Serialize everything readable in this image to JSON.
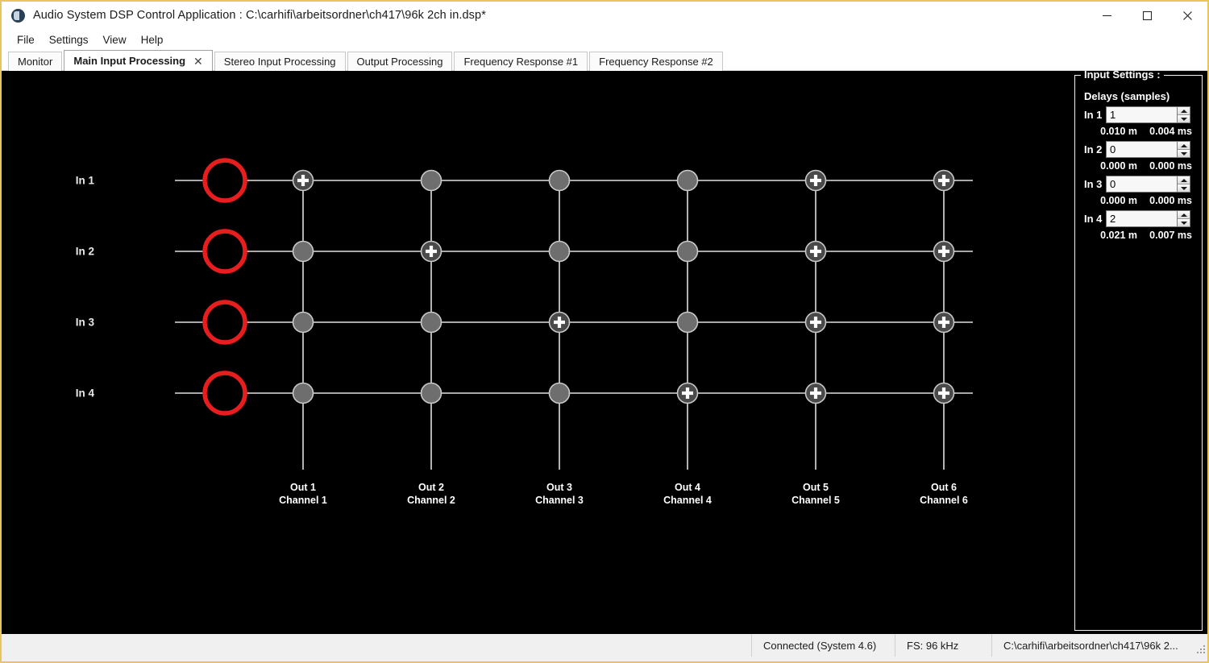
{
  "window": {
    "title": "Audio System DSP Control Application : C:\\carhifi\\arbeitsordner\\ch417\\96k 2ch in.dsp*",
    "icon": "app-speaker-icon",
    "minimize_label": "Minimize",
    "maximize_label": "Maximize",
    "close_label": "Close",
    "border_color": "#e8c65c"
  },
  "menubar": {
    "items": [
      {
        "label": "File"
      },
      {
        "label": "Settings"
      },
      {
        "label": "View"
      },
      {
        "label": "Help"
      }
    ]
  },
  "tabs": {
    "items": [
      {
        "label": "Monitor",
        "active": false,
        "closable": false
      },
      {
        "label": "Main Input Processing",
        "active": true,
        "closable": true,
        "close_glyph": "✕"
      },
      {
        "label": "Stereo Input Processing",
        "active": false,
        "closable": false
      },
      {
        "label": "Output Processing",
        "active": false,
        "closable": false
      },
      {
        "label": "Frequency Response #1",
        "active": false,
        "closable": false
      },
      {
        "label": "Frequency Response #2",
        "active": false,
        "closable": false
      }
    ]
  },
  "matrix": {
    "background": "#000000",
    "line_color": "#e0e0e0",
    "input_ring_color": "#e81e1e",
    "node_inactive_color": "#6e6e6e",
    "node_active_color": "#4a4a4a",
    "node_ring_color": "#c9c9c9",
    "inputs": [
      {
        "label": "In 1"
      },
      {
        "label": "In 2"
      },
      {
        "label": "In 3"
      },
      {
        "label": "In 4"
      }
    ],
    "outputs": [
      {
        "label": "Out 1",
        "channel": "Channel 1"
      },
      {
        "label": "Out 2",
        "channel": "Channel 2"
      },
      {
        "label": "Out 3",
        "channel": "Channel 3"
      },
      {
        "label": "Out 4",
        "channel": "Channel 4"
      },
      {
        "label": "Out 5",
        "channel": "Channel 5"
      },
      {
        "label": "Out 6",
        "channel": "Channel 6"
      }
    ],
    "crosspoints": [
      [
        1,
        0,
        0,
        0,
        1,
        1
      ],
      [
        0,
        1,
        0,
        0,
        1,
        1
      ],
      [
        0,
        0,
        1,
        0,
        1,
        1
      ],
      [
        0,
        0,
        0,
        1,
        1,
        1
      ]
    ],
    "active_glyph": "+"
  },
  "input_settings": {
    "title": "Input Settings :",
    "subtitle": "Delays (samples)",
    "delays": [
      {
        "label": "In 1",
        "value": "1",
        "meters": "0.010 m",
        "millis": "0.004 ms"
      },
      {
        "label": "In 2",
        "value": "0",
        "meters": "0.000 m",
        "millis": "0.000 ms"
      },
      {
        "label": "In 3",
        "value": "0",
        "meters": "0.000 m",
        "millis": "0.000 ms"
      },
      {
        "label": "In 4",
        "value": "2",
        "meters": "0.021 m",
        "millis": "0.007 ms"
      }
    ]
  },
  "statusbar": {
    "connection": "Connected (System 4.6)",
    "sample_rate": "FS: 96 kHz",
    "file_path": "C:\\carhifi\\arbeitsordner\\ch417\\96k 2..."
  }
}
